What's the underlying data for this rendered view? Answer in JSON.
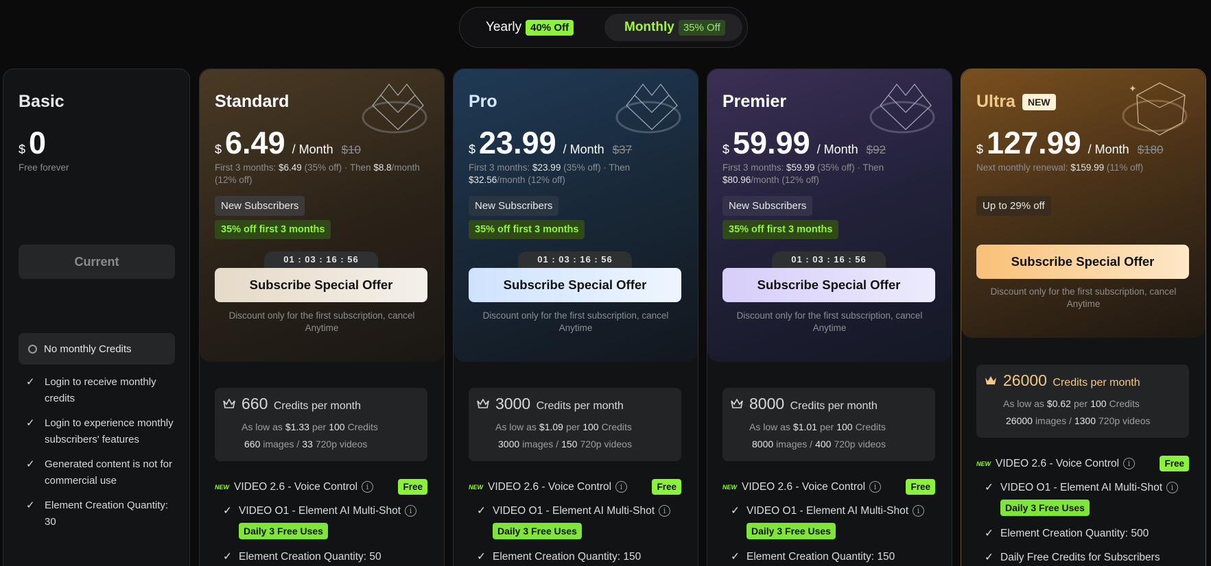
{
  "toggle": {
    "yearly_label": "Yearly",
    "yearly_badge": "40% Off",
    "monthly_label": "Monthly",
    "monthly_badge": "35% Off",
    "selected": "Monthly"
  },
  "plans": {
    "basic": {
      "name": "Basic",
      "currency": "$",
      "price": "0",
      "note": "Free forever",
      "current_label": "Current",
      "no_credits": "No monthly Credits",
      "features": [
        "Login to receive monthly credits",
        "Login to experience monthly subscribers' features",
        "Generated content is not for commercial use",
        "Element Creation Quantity: 30"
      ]
    },
    "standard": {
      "name": "Standard",
      "currency": "$",
      "price": "6.49",
      "per": "/ Month",
      "original": "$10",
      "note_a": "First 3 months: ",
      "note_b": "$6.49",
      "note_c": " (35% off) · Then ",
      "note_d": "$8.8",
      "note_e": "/month (12% off)",
      "new_sub": "New Subscribers",
      "discount": "35% off first 3 months",
      "timer": "01 : 03 : 16 : 56",
      "subscribe": "Subscribe Special Offer",
      "cancel": "Discount only for the first subscription, cancel Anytime",
      "credits": "660",
      "credits_label": "Credits per month",
      "low_as": "As low as",
      "low_price": "$1.33",
      "per_word": "per",
      "per_credits": "100",
      "credits_word": "Credits",
      "images": "660",
      "images_word": "images /",
      "videos": "33",
      "videos_word": "720p videos",
      "f_video": "VIDEO 2.6 - Voice Control",
      "f_free": "Free",
      "f_o1": "VIDEO O1 - Element AI Multi-Shot",
      "f_daily": "Daily 3 Free Uses",
      "f_element": "Element Creation Quantity: 50"
    },
    "pro": {
      "name": "Pro",
      "currency": "$",
      "price": "23.99",
      "per": "/ Month",
      "original": "$37",
      "note_a": "First 3 months: ",
      "note_b": "$23.99",
      "note_c": " (35% off) · Then ",
      "note_d": "$32.56",
      "note_e": "/month (12% off)",
      "new_sub": "New Subscribers",
      "discount": "35% off first 3 months",
      "timer": "01 : 03 : 16 : 56",
      "subscribe": "Subscribe Special Offer",
      "cancel": "Discount only for the first subscription, cancel Anytime",
      "credits": "3000",
      "credits_label": "Credits per month",
      "low_as": "As low as",
      "low_price": "$1.09",
      "per_word": "per",
      "per_credits": "100",
      "credits_word": "Credits",
      "images": "3000",
      "images_word": "images /",
      "videos": "150",
      "videos_word": "720p videos",
      "f_video": "VIDEO 2.6 - Voice Control",
      "f_free": "Free",
      "f_o1": "VIDEO O1 - Element AI Multi-Shot",
      "f_daily": "Daily 3 Free Uses",
      "f_element": "Element Creation Quantity: 150"
    },
    "premier": {
      "name": "Premier",
      "currency": "$",
      "price": "59.99",
      "per": "/ Month",
      "original": "$92",
      "note_a": "First 3 months: ",
      "note_b": "$59.99",
      "note_c": " (35% off) · Then ",
      "note_d": "$80.96",
      "note_e": "/month (12% off)",
      "new_sub": "New Subscribers",
      "discount": "35% off first 3 months",
      "timer": "01 : 03 : 16 : 56",
      "subscribe": "Subscribe Special Offer",
      "cancel": "Discount only for the first subscription, cancel Anytime",
      "credits": "8000",
      "credits_label": "Credits per month",
      "low_as": "As low as",
      "low_price": "$1.01",
      "per_word": "per",
      "per_credits": "100",
      "credits_word": "Credits",
      "images": "8000",
      "images_word": "images /",
      "videos": "400",
      "videos_word": "720p videos",
      "f_video": "VIDEO 2.6 - Voice Control",
      "f_free": "Free",
      "f_o1": "VIDEO O1 - Element AI Multi-Shot",
      "f_daily": "Daily 3 Free Uses",
      "f_element": "Element Creation Quantity: 150"
    },
    "ultra": {
      "name": "Ultra",
      "new_tag": "NEW",
      "currency": "$",
      "price": "127.99",
      "per": "/ Month",
      "original": "$180",
      "note_a": "Next monthly renewal: ",
      "note_b": "$159.99",
      "note_c": " (11% off)",
      "up_to": "Up to 29% off",
      "subscribe": "Subscribe Special Offer",
      "cancel": "Discount only for the first subscription, cancel Anytime",
      "credits": "26000",
      "credits_label": "Credits per month",
      "low_as": "As low as",
      "low_price": "$0.62",
      "per_word": "per",
      "per_credits": "100",
      "credits_word": "Credits",
      "images": "26000",
      "images_word": "images /",
      "videos": "1300",
      "videos_word": "720p videos",
      "f_video": "VIDEO 2.6 - Voice Control",
      "f_free": "Free",
      "f_o1": "VIDEO O1 - Element AI Multi-Shot",
      "f_daily": "Daily 3 Free Uses",
      "f_element": "Element Creation Quantity: 500",
      "f_daily_credits": "Daily Free Credits for Subscribers"
    }
  },
  "icons": {
    "new": "NEW",
    "check": "✓",
    "info": "i"
  },
  "colors": {
    "accent_green": "#8bf23a",
    "ultra_gold": "#f3c889"
  }
}
